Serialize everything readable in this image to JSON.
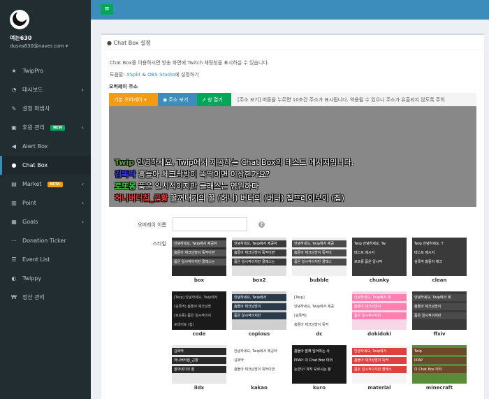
{
  "sidebar": {
    "user_name": "여는630",
    "user_email": "dusns630@naver.com ▾",
    "items": [
      {
        "label": "TwipPro",
        "icon": "★",
        "icon_name": "star-icon"
      },
      {
        "label": "대시보드",
        "icon": "◔",
        "icon_name": "dashboard-icon",
        "chevron": "‹"
      },
      {
        "label": "설정 마법사",
        "icon": "✎",
        "icon_name": "magic-wand-icon"
      },
      {
        "label": "후원 관리",
        "icon": "▣",
        "icon_name": "gift-icon",
        "badge": "NEW",
        "chevron": "‹"
      },
      {
        "label": "Alert Box",
        "icon": "◀",
        "icon_name": "bullhorn-icon"
      },
      {
        "label": "Chat Box",
        "icon": "●",
        "icon_name": "comment-icon",
        "active": true
      },
      {
        "label": "Market",
        "icon": "▤",
        "icon_name": "cart-icon",
        "badge": "BETA",
        "chevron": "‹"
      },
      {
        "label": "Point",
        "icon": "▥",
        "icon_name": "chart-icon",
        "chevron": "‹"
      },
      {
        "label": "Goals",
        "icon": "▦",
        "icon_name": "goals-icon",
        "chevron": "‹"
      },
      {
        "label": "Donation Ticker",
        "icon": "⋯",
        "icon_name": "ellipsis-icon"
      },
      {
        "label": "Event List",
        "icon": "☰",
        "icon_name": "list-icon"
      },
      {
        "label": "Twippy",
        "icon": "◐",
        "icon_name": "twippy-icon"
      },
      {
        "label": "정산 관리",
        "icon": "₩",
        "icon_name": "won-icon"
      }
    ]
  },
  "topbar": {
    "toggle_icon": "≡"
  },
  "panel": {
    "title": "Chat Box 설정",
    "title_icon": "●",
    "desc1": "Chat Box를 이용하시면 방송 화면에 Twitch 채팅창을 표시하실 수 있습니다.",
    "desc2_prefix": "도움말: ",
    "desc2_link1": "XSplit",
    "desc2_amp": " & ",
    "desc2_link2": "OBS Studio",
    "desc2_suffix": "에 설정하기",
    "overlay_label": "오버레이 주소",
    "btn_default": "기본 오버레이 ▾",
    "btn_show": "◉ 주소 보기",
    "btn_open": "⇗ 창 열기",
    "address_note": "[주소 보기] 버튼을 누르면 10초간 주소가 표시됩니다. 악용될 수 있으니 주소가 유출되지 않도록 주의",
    "name_label": "오버레이 이름",
    "name_value": "",
    "help_icon": "?",
    "style_label": "스타일"
  },
  "preview": {
    "lines": [
      {
        "name": "Twip",
        "color": "#5b9e3a",
        "text": " 안녕하세요, Twip에서 제공하는 Chat Box의 테스트 메시지입니다."
      },
      {
        "name": "김똑딱",
        "color": "#3a3aff",
        "text": " 흠들아 체크남방이 뚝딱이면 이상한가요?"
      },
      {
        "name": "로또몽",
        "color": "#3cdc3c",
        "text": " 품은 일시적이지만 클래스는 영원하다"
      },
      {
        "name": "허니버터칩_근황",
        "color": "#ff3030",
        "text": " 꿀꺼내기의 꿀 (허니) 버터의 (버터) 칩프레이보이 (칩)"
      }
    ]
  },
  "styles": [
    {
      "name": "box",
      "bg": "#2a2a2a",
      "band": "#555555",
      "line_color": "#ffffff",
      "lines": [
        "안녕하세요, Twip에서 제공하",
        "흠들아 체크남방이 뚝딱이면",
        "품은 일시적이지만 클래스는"
      ]
    },
    {
      "name": "box2",
      "bg": "#e0e0e0",
      "band": "#3a3a3a",
      "line_color": "#ffffff",
      "lines": [
        "안녕하세요, Twip에서 제공하",
        "흠들아 체크남방이 뚝딱이면",
        "품은 일시적이지만 클래스는"
      ]
    },
    {
      "name": "bubble",
      "bg": "#f0f0f0",
      "band": "#4a4a4a",
      "line_color": "#ffffff",
      "lines": [
        "안녕하세요, Twip에서 제공",
        "흠들아 체크남방이 뚝딱이",
        "품은 일시적이지만 클래스"
      ]
    },
    {
      "name": "chunky",
      "bg": "#3a3a3a",
      "band": "#3a3a3a",
      "line_color": "#ffffff",
      "lines": [
        "Twip 안녕하세요. Tw",
        "테스트 메시지",
        "로또몽 품은 일시적"
      ]
    },
    {
      "name": "clean",
      "bg": "#3a3a3a",
      "band": "#3a3a3a",
      "line_color": "#ffffff",
      "lines": [
        "Twip 안녕하세요. T",
        "테스트 메시지",
        "김똑딱 흠들아 체크"
      ]
    },
    {
      "name": "code",
      "bg": "#1a1a1a",
      "band": "#1a1a1a",
      "line_color": "#c8c8c8",
      "lines": [
        "[Twip] 안녕하세요, Twip에서",
        "(김똑딱) 흠들아 체크남방",
        "(로또몽) 품은 일시적이지",
        "포테이토 (칩)"
      ]
    },
    {
      "name": "copious",
      "bg": "#cfcfcf",
      "band": "#2a3a4a",
      "line_color": "#ffffff",
      "lines": [
        "안녕하세요, Twip에서",
        "흠들아 체크남방이",
        "품은 일시적이지만"
      ]
    },
    {
      "name": "dc",
      "bg": "#ffffff",
      "band": "#ffffff",
      "line_color": "#333333",
      "lines": [
        "[Twip]",
        "안녕하세요, Twip에서 제공",
        "[김똑딱]",
        "흠들아 체크남방이 뚝딱"
      ]
    },
    {
      "name": "dokidoki",
      "bg": "#f8d8e8",
      "band": "#ff80b0",
      "line_color": "#ffffff",
      "lines": [
        "안녕하세요, Twip에서 제",
        "흠들아 체크남방이",
        "품은 일시적이지만"
      ]
    },
    {
      "name": "ffxiv",
      "bg": "#3a3a3a",
      "band": "#4a4a4a",
      "line_color": "#ffffff",
      "lines": [
        "안녕하세요, Twip에서 제",
        "흠들아 체크남방이",
        "품은 일시적이지만"
      ]
    },
    {
      "name": "ildx",
      "bg": "#e8e8e8",
      "band": "#2a2a2a",
      "line_color": "#ffffff",
      "lines": [
        "김똑딱",
        "허니버터칩_근황",
        "꿀꺼내기의 꿀"
      ]
    },
    {
      "name": "kakao",
      "bg": "#ffffff",
      "band": "#ffffff",
      "line_color": "#333333",
      "lines": [
        "안녕하세요, Twip에서 제공하",
        "김똑딱",
        "흠들아 체크남방이 뚝딱이면"
      ]
    },
    {
      "name": "kuro",
      "bg": "#1a1a1a",
      "band": "#1a1a1a",
      "line_color": "#ffffff",
      "lines": [
        "흠들아 말해 입어마는 사",
        "PPAP: 이 Chat Box 마저",
        "는군나! 자지 모르시는 분"
      ]
    },
    {
      "name": "material",
      "bg": "#f5f5f5",
      "band": "#e04040",
      "line_color": "#ffffff",
      "lines": [
        "안녕하세요, Twip에서",
        "흠들아 체크남방이 뚝딱",
        "품은 일시적이지만 클래스"
      ]
    },
    {
      "name": "minecraft",
      "bg": "#5a8a3a",
      "band": "#6a4a2a",
      "line_color": "#ffffff",
      "lines": [
        "Twip",
        "PPAP",
        "이 Chat Box 마저"
      ]
    }
  ]
}
